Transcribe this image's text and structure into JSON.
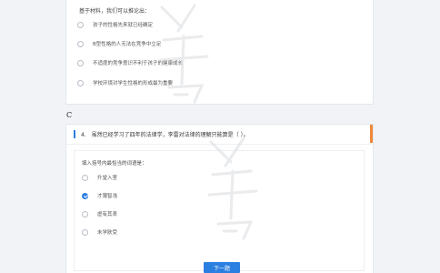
{
  "previous_question": {
    "intro": "基于材料，我们可以推论出：",
    "options": [
      {
        "label": "孩子的性格先来就已经确定",
        "selected": false
      },
      {
        "label": "B型性格的人无法在竞争中立足",
        "selected": false
      },
      {
        "label": "不适度的竞争意识不利于孩子的健康成长",
        "selected": false
      },
      {
        "label": "学校环境对学生性格的形成最为重要",
        "selected": false
      }
    ]
  },
  "section_letter": "C",
  "question": {
    "number": "4.",
    "text": "虽然已经学习了四年的法律学，李雷对法律的理解只能算是（ ）。",
    "prompt": "填入括号内最恰当的词语是：",
    "options": [
      {
        "label": "升堂入室",
        "selected": false
      },
      {
        "label": "才薄智浅",
        "selected": true
      },
      {
        "label": "虚有其表",
        "selected": false
      },
      {
        "label": "未学肤受",
        "selected": false
      }
    ]
  },
  "next_button": {
    "label": "下一题"
  },
  "colors": {
    "accent": "#2b7fe0",
    "scroll_indicator": "#f0883a"
  }
}
